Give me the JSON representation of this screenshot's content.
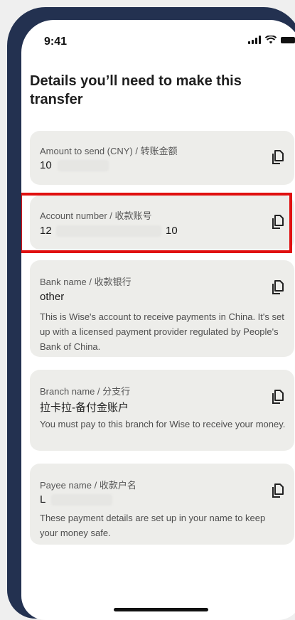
{
  "status_bar": {
    "time": "9:41",
    "icons": [
      "signal-icon",
      "wifi-icon",
      "battery-icon"
    ]
  },
  "page": {
    "title": "Details you’ll need to make this transfer"
  },
  "cards": {
    "amount": {
      "label": "Amount to send (CNY) / 转账金额",
      "value": "10"
    },
    "account": {
      "label": "Account number / 收款账号",
      "value_start": "12",
      "value_end": "10"
    },
    "bank": {
      "label": "Bank name / 收款银行",
      "value": "other",
      "note": "This is Wise's account to receive payments in China. It's set up with a licensed payment provider regulated by People's Bank of China."
    },
    "branch": {
      "label": "Branch name / 分支行",
      "value": "拉卡拉-备付金账户",
      "note": "You must pay to this branch for Wise to receive your money."
    },
    "payee": {
      "label": "Payee name / 收款户名",
      "value": "L",
      "note": "These payment details are set up in your name to keep your money safe."
    }
  },
  "colors": {
    "highlight": "#e01010",
    "card_bg": "#ededea",
    "phone_frame": "#233150"
  }
}
